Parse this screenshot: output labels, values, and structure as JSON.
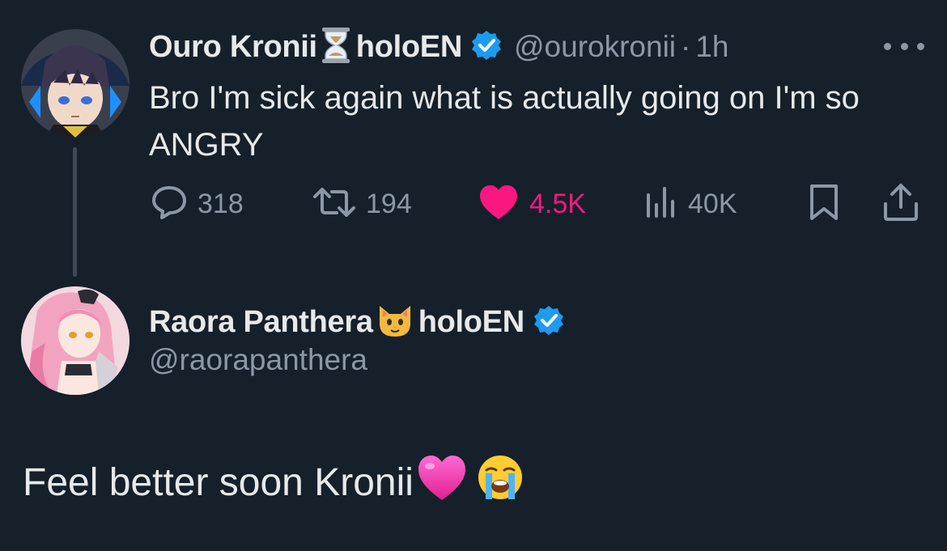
{
  "tweet": {
    "author": {
      "name": "Ouro Kronii",
      "name_suffix": "holoEN",
      "handle": "@ourokronii",
      "name_emoji": "hourglass-emoji",
      "verified": true
    },
    "separator": "·",
    "time": "1h",
    "text": "Bro I'm sick again what is actually going on I'm so ANGRY",
    "actions": {
      "replies": "318",
      "reposts": "194",
      "likes": "4.5K",
      "views": "40K",
      "liked": true
    }
  },
  "reply": {
    "author": {
      "name": "Raora Panthera",
      "name_suffix": "holoEN",
      "handle": "@raorapanthera",
      "name_emoji": "cat-face-emoji",
      "verified": true
    },
    "text": "Feel better soon Kronii",
    "text_emojis": [
      "pink-heart-emoji",
      "loudly-crying-face-emoji"
    ]
  },
  "colors": {
    "background": "#15202b",
    "text_primary": "#e7e9ea",
    "text_secondary": "#8b98a5",
    "like_pink": "#f91880",
    "verified_blue": "#1d9bf0",
    "thread_line": "#3e4a55"
  },
  "icons": {
    "reply": "speech-bubble-icon",
    "repost": "repost-icon",
    "like": "heart-icon",
    "views": "bar-chart-icon",
    "bookmark": "bookmark-icon",
    "share": "share-icon",
    "more": "more-dots-icon"
  }
}
